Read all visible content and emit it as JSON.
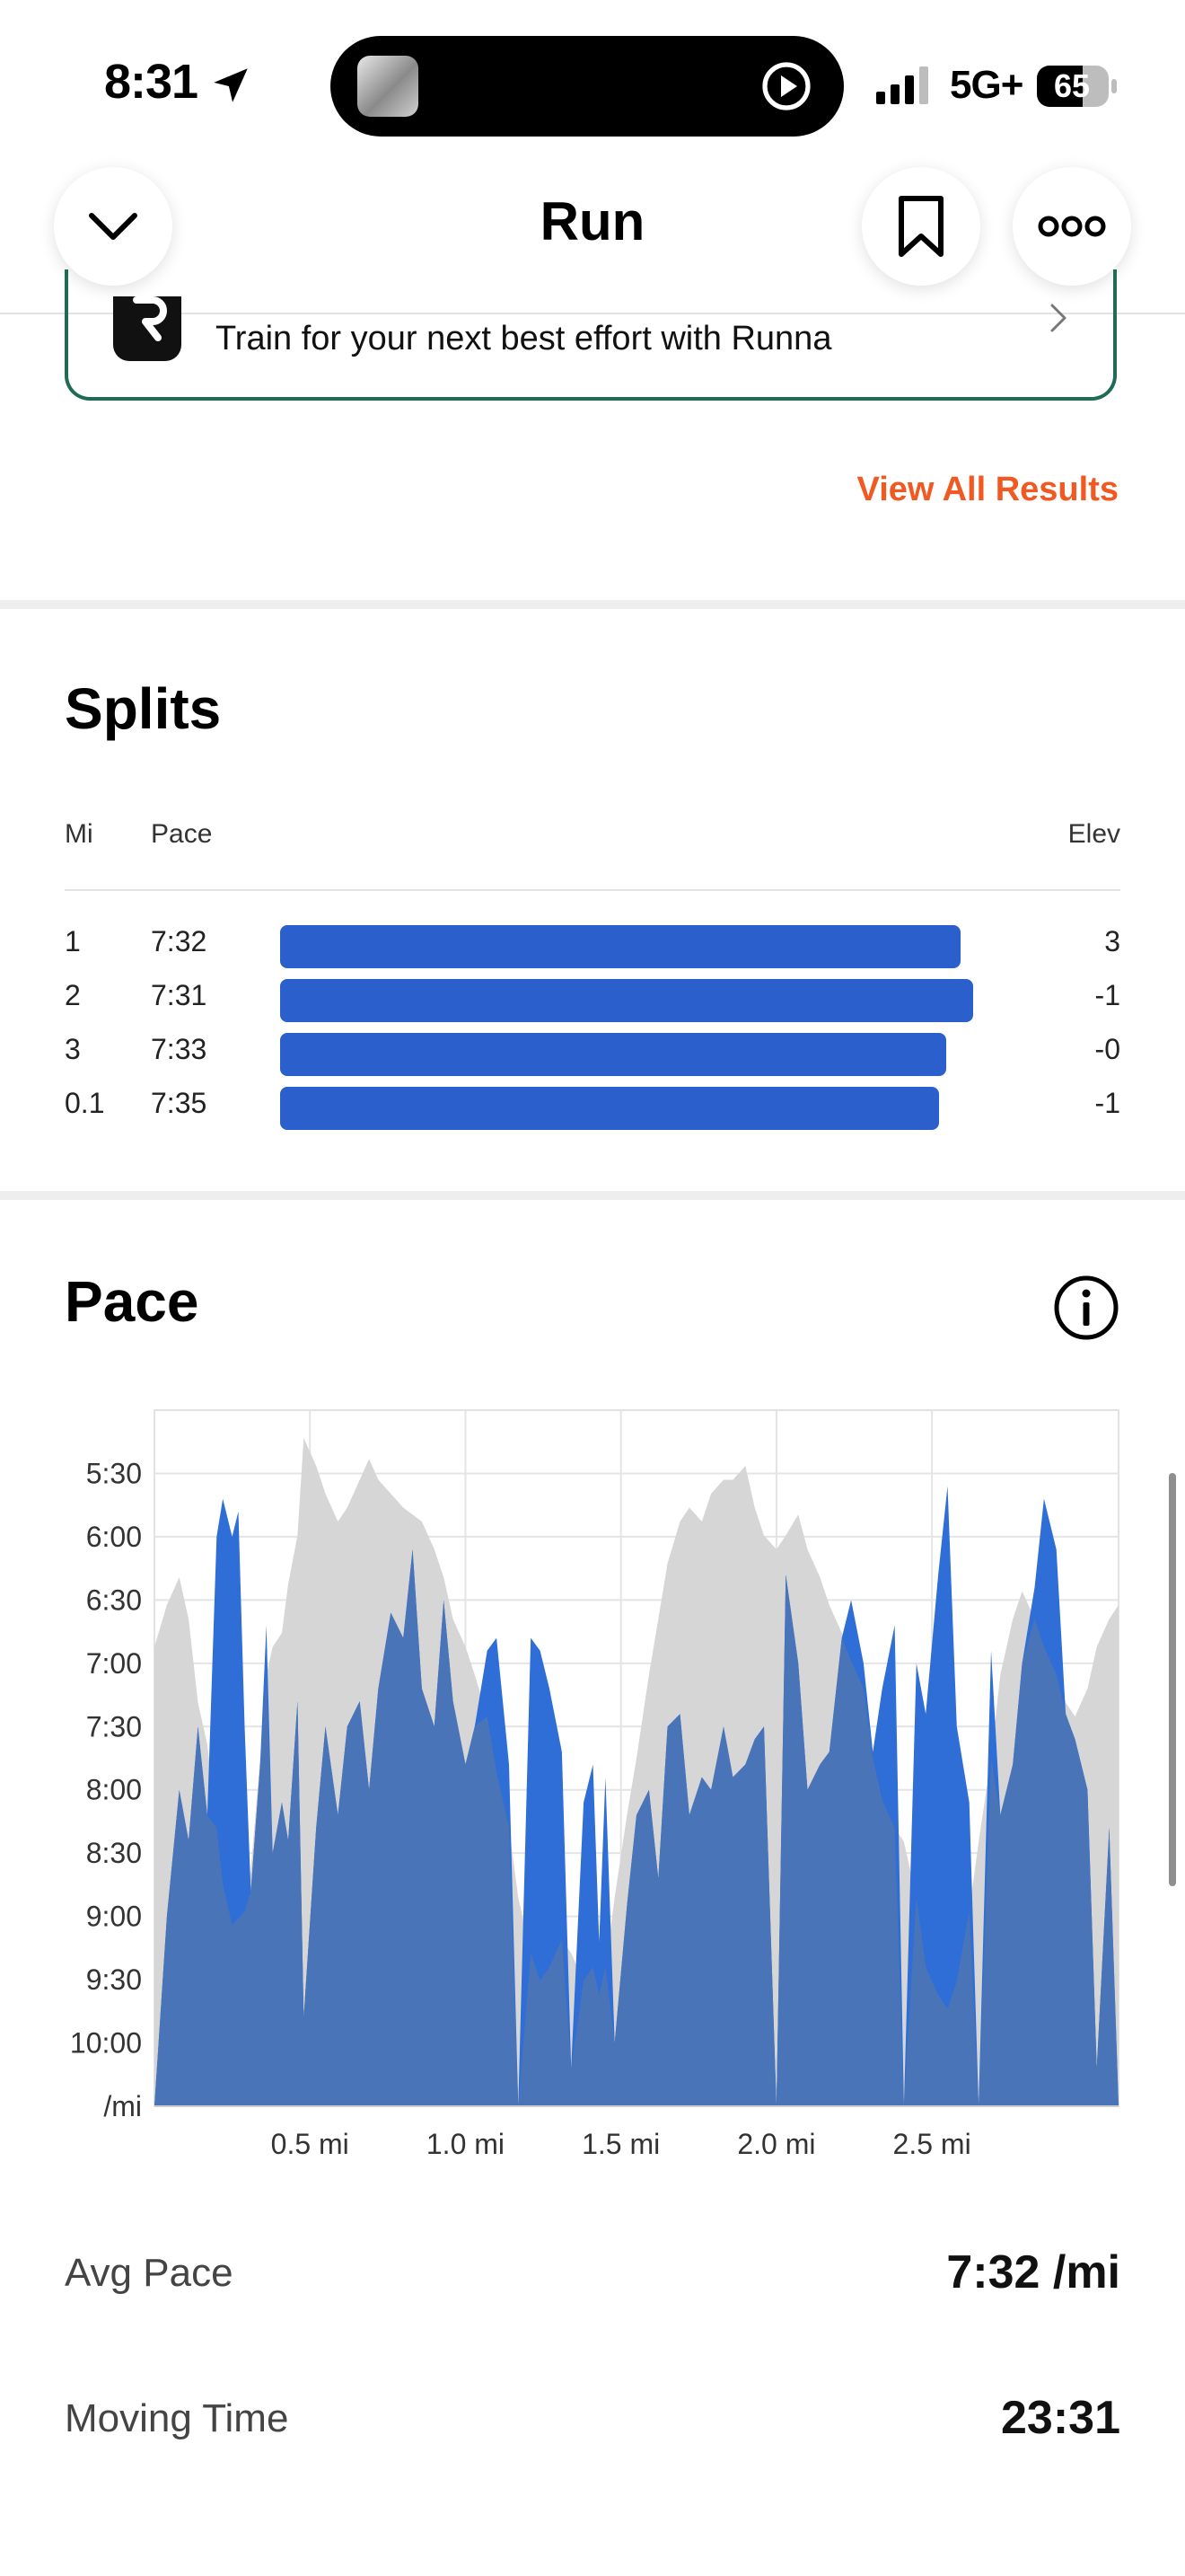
{
  "status_bar": {
    "time": "8:31",
    "network": "5G+",
    "battery": "65",
    "icons": [
      "location-arrow-icon",
      "now-playing-thumbnail",
      "play-icon",
      "signal-bars-icon",
      "battery-icon"
    ]
  },
  "header": {
    "title": "Run",
    "back_icon": "chevron-down-icon",
    "bookmark_icon": "bookmark-icon",
    "more_icon": "more-dots-icon"
  },
  "promo": {
    "text": "Train for your next best effort with Runna",
    "logo_icon": "runna-logo-icon",
    "chevron_icon": "chevron-right-icon",
    "border_color": "#1f6b55"
  },
  "results_link": "View All Results",
  "splits": {
    "title": "Splits",
    "headers": {
      "mi": "Mi",
      "pace": "Pace",
      "elev": "Elev"
    },
    "bar_color": "#2a5fcc",
    "rows": [
      {
        "mi": "1",
        "pace": "7:32",
        "elev": "3"
      },
      {
        "mi": "2",
        "pace": "7:31",
        "elev": "-1"
      },
      {
        "mi": "3",
        "pace": "7:33",
        "elev": "-0"
      },
      {
        "mi": "0.1",
        "pace": "7:35",
        "elev": "-1"
      }
    ]
  },
  "pace": {
    "title": "Pace",
    "info_icon": "info-icon"
  },
  "chart_data": {
    "type": "area",
    "title": "Pace",
    "xlabel": "",
    "ylabel": "/mi",
    "x_ticks": [
      "0.5 mi",
      "1.0 mi",
      "1.5 mi",
      "2.0 mi",
      "2.5 mi"
    ],
    "y_ticks": [
      "5:30",
      "6:00",
      "6:30",
      "7:00",
      "7:30",
      "8:00",
      "8:30",
      "9:00",
      "9:30",
      "10:00",
      "/mi"
    ],
    "xlim": [
      0,
      3.1
    ],
    "ylim_min_per_mile": [
      5.0,
      10.5
    ],
    "y_inverted": true,
    "grid": true,
    "colors": {
      "pace": "#2f6ed6",
      "elevation": "#d6d6d6",
      "overlap": "#4a74b8"
    },
    "series": [
      {
        "x": [
          0.0,
          0.04,
          0.08,
          0.11,
          0.14,
          0.17,
          0.2,
          0.22,
          0.25,
          0.27,
          0.29,
          0.31,
          0.34,
          0.36,
          0.38,
          0.41,
          0.43,
          0.46,
          0.48,
          0.52,
          0.55,
          0.59,
          0.62,
          0.66,
          0.69,
          0.72,
          0.76,
          0.8,
          0.83,
          0.86,
          0.9,
          0.93,
          0.96,
          1.0,
          1.03,
          1.07,
          1.1,
          1.14,
          1.17,
          1.21,
          1.24,
          1.27,
          1.31,
          1.34,
          1.38,
          1.41,
          1.43,
          1.45,
          1.48,
          1.52,
          1.55,
          1.59,
          1.62,
          1.65,
          1.69,
          1.72,
          1.76,
          1.79,
          1.83,
          1.86,
          1.9,
          1.93,
          1.96,
          2.0,
          2.03,
          2.07,
          2.1,
          2.14,
          2.17,
          2.21,
          2.24,
          2.28,
          2.31,
          2.34,
          2.38,
          2.41,
          2.45,
          2.48,
          2.52,
          2.55,
          2.58,
          2.62,
          2.65,
          2.69,
          2.72,
          2.76,
          2.79,
          2.83,
          2.86,
          2.9,
          2.93,
          2.96,
          3.0,
          3.03,
          3.07,
          3.1
        ],
        "pace": [
          10.5,
          9.0,
          8.0,
          8.4,
          7.5,
          8.2,
          6.0,
          5.7,
          6.0,
          5.8,
          7.5,
          8.8,
          7.8,
          6.7,
          8.5,
          8.1,
          8.4,
          7.3,
          9.8,
          8.3,
          7.5,
          8.2,
          7.5,
          7.3,
          8.0,
          7.2,
          6.6,
          6.8,
          6.1,
          7.2,
          7.5,
          6.5,
          7.3,
          7.8,
          7.5,
          6.9,
          6.8,
          7.8,
          10.5,
          6.8,
          6.9,
          7.2,
          7.7,
          10.2,
          8.1,
          7.8,
          9.2,
          7.9,
          10.0,
          8.9,
          8.2,
          8.0,
          8.7,
          7.5,
          7.4,
          8.2,
          7.9,
          8.0,
          7.5,
          7.9,
          7.8,
          7.6,
          7.5,
          10.5,
          6.3,
          7.0,
          8.0,
          7.8,
          7.7,
          6.8,
          6.5,
          7.0,
          7.7,
          7.2,
          6.7,
          10.5,
          7.0,
          7.4,
          6.3,
          5.6,
          7.5,
          8.1,
          10.5,
          6.9,
          8.2,
          7.8,
          7.0,
          6.4,
          5.7,
          6.1,
          7.4,
          7.6,
          8.0,
          10.2,
          8.3,
          10.5
        ],
        "elevation_shade_relative": [
          0.66,
          0.72,
          0.76,
          0.7,
          0.58,
          0.52,
          0.4,
          0.32,
          0.26,
          0.27,
          0.28,
          0.34,
          0.5,
          0.62,
          0.66,
          0.68,
          0.75,
          0.82,
          0.96,
          0.92,
          0.88,
          0.84,
          0.86,
          0.9,
          0.93,
          0.9,
          0.88,
          0.86,
          0.85,
          0.84,
          0.8,
          0.76,
          0.7,
          0.66,
          0.62,
          0.56,
          0.48,
          0.4,
          0.3,
          0.22,
          0.18,
          0.2,
          0.24,
          0.22,
          0.18,
          0.2,
          0.16,
          0.2,
          0.3,
          0.42,
          0.5,
          0.62,
          0.7,
          0.78,
          0.84,
          0.86,
          0.84,
          0.88,
          0.9,
          0.9,
          0.92,
          0.86,
          0.82,
          0.8,
          0.82,
          0.85,
          0.8,
          0.76,
          0.72,
          0.68,
          0.64,
          0.6,
          0.5,
          0.44,
          0.4,
          0.38,
          0.3,
          0.2,
          0.16,
          0.14,
          0.18,
          0.28,
          0.38,
          0.5,
          0.62,
          0.7,
          0.74,
          0.7,
          0.66,
          0.62,
          0.58,
          0.56,
          0.6,
          0.66,
          0.7,
          0.72
        ]
      }
    ]
  },
  "stats": [
    {
      "label": "Avg Pace",
      "value": "7:32 /mi"
    },
    {
      "label": "Moving Time",
      "value": "23:31"
    }
  ]
}
